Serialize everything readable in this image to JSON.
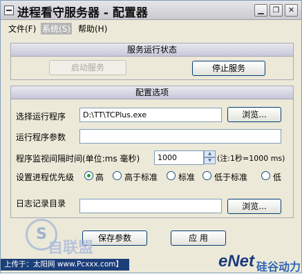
{
  "window": {
    "title": "进程看守服务器 - 配置器",
    "controls": {
      "minimize": "▁",
      "restore": "❐",
      "close": "✕"
    }
  },
  "menu": [
    {
      "label": "文件(F)"
    },
    {
      "label": "系统(S)",
      "selected": true
    },
    {
      "label": "帮助(H)"
    }
  ],
  "status_group": {
    "title": "服务运行状态",
    "start_button": "启动服务",
    "stop_button": "停止服务"
  },
  "config_group": {
    "title": "配置选项",
    "program_label": "选择运行程序",
    "program_value": "D:\\TT\\TCPlus.exe",
    "browse_button": "浏览...",
    "params_label": "运行程序参数",
    "params_value": "",
    "interval_label": "程序监视间隔时间(单位:ms 毫秒)",
    "interval_value": "1000",
    "interval_hint": "(注:1秒=1000 ms)",
    "priority_label": "设置进程优先级",
    "priorities": [
      "高",
      "高于标准",
      "标准",
      "低于标准",
      "低"
    ],
    "priority_selected": "高",
    "log_label": "日志记录目录",
    "log_value": "",
    "log_browse_button": "浏览..."
  },
  "actions": {
    "save_button": "保存参数",
    "apply_button": "应 用"
  },
  "watermark": {
    "logo_letter": "S",
    "brand_text": "自联盟",
    "upload_text": "上传于：太阳网 www.Pcxxx.com】",
    "enet_logo": "eNet",
    "enet_sub": "硅谷动力"
  },
  "colors": {
    "window_bg": "#ece9d8",
    "titlebar_bg": "#d4d4da",
    "button_border": "#003c74",
    "radio_dot": "#21a121"
  }
}
